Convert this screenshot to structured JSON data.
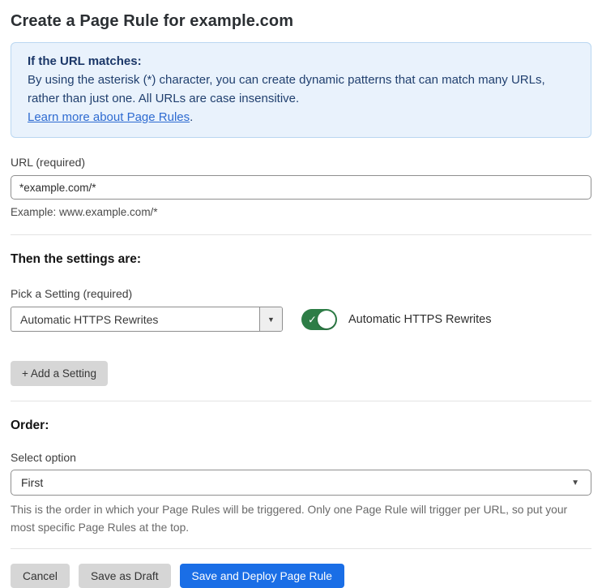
{
  "page": {
    "title": "Create a Page Rule for example.com"
  },
  "info_box": {
    "heading": "If the URL matches:",
    "body": "By using the asterisk (*) character, you can create dynamic patterns that can match many URLs, rather than just one. All URLs are case insensitive.",
    "link_label": "Learn more about Page Rules",
    "link_suffix": "."
  },
  "url_field": {
    "label": "URL (required)",
    "value": "*example.com/*",
    "hint": "Example: www.example.com/*"
  },
  "settings_section": {
    "heading": "Then the settings are:",
    "picker_label": "Pick a Setting (required)",
    "picker_value": "Automatic HTTPS Rewrites",
    "caret": "▼",
    "toggle_state": "on",
    "toggle_check": "✓",
    "toggle_label": "Automatic HTTPS Rewrites",
    "add_setting_label": "+ Add a Setting"
  },
  "order_section": {
    "heading": "Order:",
    "select_label": "Select option",
    "select_value": "First",
    "caret": "▼",
    "help_text": "This is the order in which your Page Rules will be triggered. Only one Page Rule will trigger per URL, so put your most specific Page Rules at the top."
  },
  "footer": {
    "cancel_label": "Cancel",
    "save_draft_label": "Save as Draft",
    "save_deploy_label": "Save and Deploy Page Rule"
  },
  "colors": {
    "info_background": "#e9f2fc",
    "info_border": "#bad7f1",
    "info_text": "#1e3a6d",
    "link_blue": "#2e6bd1",
    "toggle_green": "#2d7d46",
    "primary_blue": "#1a6ee6",
    "button_gray": "#d6d6d6"
  }
}
